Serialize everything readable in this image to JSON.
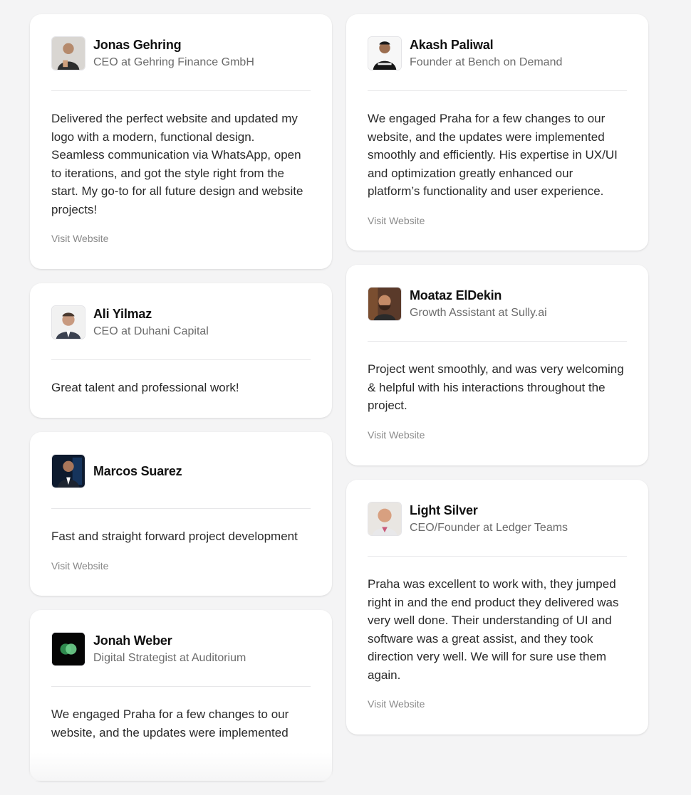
{
  "testimonials_left": [
    {
      "name": "Jonas Gehring",
      "role": "CEO at Gehring Finance GmbH",
      "quote": "Delivered the perfect website and updated my logo with a modern, functional design. Seamless communication via WhatsApp, open to iterations, and got the style right from the start. My go-to for all future design and website projects!",
      "link": "Visit Website"
    },
    {
      "name": "Ali Yilmaz",
      "role": "CEO at Duhani Capital",
      "quote": "Great talent and professional work!"
    },
    {
      "name": "Marcos Suarez",
      "quote": "Fast and straight forward project development",
      "link": "Visit Website"
    },
    {
      "name": "Jonah Weber",
      "role": "Digital Strategist at Auditorium",
      "quote": "We engaged Praha for a few changes to our website, and the updates were implemented"
    }
  ],
  "testimonials_right": [
    {
      "name": "Akash Paliwal",
      "role": "Founder at Bench on Demand",
      "quote": "We engaged Praha for a few changes to our website, and the updates were implemented smoothly and efficiently. His expertise in UX/UI and optimization greatly enhanced our platform’s functionality and user experience.",
      "link": "Visit Website"
    },
    {
      "name": "Moataz ElDekin",
      "role": "Growth Assistant at Sully.ai",
      "quote": "Project went smoothly, and was very welcoming & helpful with his interactions throughout the project.",
      "link": "Visit Website"
    },
    {
      "name": "Light Silver",
      "role": "CEO/Founder at Ledger Teams",
      "quote": "Praha was excellent to work with, they jumped right in and the end product they delivered was very well done. Their understanding of UI and software was a great assist, and they took direction very well. We will for sure use them again.",
      "link": "Visit Website"
    }
  ],
  "colors": {
    "background": "#f4f4f5",
    "card": "#ffffff",
    "name": "#111111",
    "role": "#6b6b6b",
    "link": "#8a8a8a"
  }
}
